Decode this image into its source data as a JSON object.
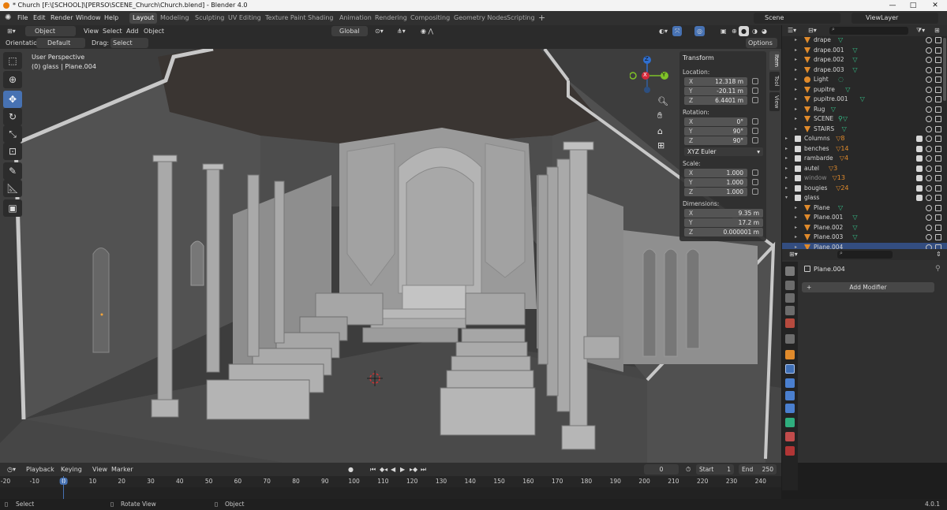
{
  "window": {
    "title": "* Church [F:\\[SCHOOL]\\[PERSO\\SCENE_Church\\Church.blend] - Blender 4.0",
    "minimize": "—",
    "maximize": "□",
    "close": "✕"
  },
  "menu": [
    "File",
    "Edit",
    "Render",
    "Window",
    "Help"
  ],
  "workspaces": [
    "Layout",
    "Modeling",
    "Sculpting",
    "UV Editing",
    "Texture Paint",
    "Shading",
    "Animation",
    "Rendering",
    "Compositing",
    "Geometry Nodes",
    "Scripting"
  ],
  "active_workspace": "Layout",
  "scene": {
    "name": "Scene",
    "view_layer": "ViewLayer"
  },
  "viewport_header": {
    "mode": "Object Mode",
    "menus": [
      "View",
      "Select",
      "Add",
      "Object"
    ],
    "transform_orientation": "Global",
    "orientation_label": "Orientation:",
    "orientation_value": "Default",
    "drag_label": "Drag:",
    "drag_value": "Select Box",
    "options": "Options"
  },
  "viewport_overlay": {
    "perspective": "User Perspective",
    "object_info": "(0) glass | Plane.004"
  },
  "gizmo_axes": {
    "x": "X",
    "y": "Y",
    "z": "Z"
  },
  "npanel": {
    "section": "Transform",
    "location_label": "Location:",
    "location": [
      {
        "axis": "X",
        "value": "12.318 m"
      },
      {
        "axis": "Y",
        "value": "-20.11 m"
      },
      {
        "axis": "Z",
        "value": "6.4401 m"
      }
    ],
    "rotation_label": "Rotation:",
    "rotation": [
      {
        "axis": "X",
        "value": "0°"
      },
      {
        "axis": "Y",
        "value": "90°"
      },
      {
        "axis": "Z",
        "value": "90°"
      }
    ],
    "rotation_mode": "XYZ Euler",
    "scale_label": "Scale:",
    "scale": [
      {
        "axis": "X",
        "value": "1.000"
      },
      {
        "axis": "Y",
        "value": "1.000"
      },
      {
        "axis": "Z",
        "value": "1.000"
      }
    ],
    "dimensions_label": "Dimensions:",
    "dimensions": [
      {
        "axis": "X",
        "value": "9.35 m"
      },
      {
        "axis": "Y",
        "value": "17.2 m"
      },
      {
        "axis": "Z",
        "value": "0.000001 m"
      }
    ],
    "tabs": [
      "Item",
      "Tool",
      "View"
    ]
  },
  "outliner": {
    "rows": [
      {
        "name": "drape",
        "type": "mesh",
        "indent": 2,
        "dec": "▽",
        "chk": false
      },
      {
        "name": "drape.001",
        "type": "mesh",
        "indent": 2,
        "dec": "▽",
        "chk": false
      },
      {
        "name": "drape.002",
        "type": "mesh",
        "indent": 2,
        "dec": "▽",
        "chk": false
      },
      {
        "name": "drape.003",
        "type": "mesh",
        "indent": 2,
        "dec": "▽",
        "chk": false
      },
      {
        "name": "Light",
        "type": "light",
        "indent": 2,
        "dec": "◌",
        "chk": false
      },
      {
        "name": "pupitre",
        "type": "mesh",
        "indent": 2,
        "dec": "▽",
        "chk": false
      },
      {
        "name": "pupitre.001",
        "type": "mesh",
        "indent": 2,
        "dec": "▽",
        "chk": false
      },
      {
        "name": "Rug",
        "type": "mesh",
        "indent": 2,
        "dec": "▽",
        "chk": false
      },
      {
        "name": "SCENE",
        "type": "mesh",
        "indent": 2,
        "dec": "⚲▽",
        "chk": false
      },
      {
        "name": "STAIRS",
        "type": "mesh",
        "indent": 2,
        "dec": "▽",
        "chk": false
      },
      {
        "name": "Columns",
        "type": "collection",
        "indent": 1,
        "dec": "▽8",
        "chk": true
      },
      {
        "name": "benches",
        "type": "collection",
        "indent": 1,
        "dec": "▽14",
        "chk": true
      },
      {
        "name": "rambarde",
        "type": "collection",
        "indent": 1,
        "dec": "▽4",
        "chk": true
      },
      {
        "name": "autel",
        "type": "collection",
        "indent": 1,
        "dec": "▽3",
        "chk": true
      },
      {
        "name": "window",
        "type": "collection",
        "indent": 1,
        "dec": "▽13",
        "chk": true,
        "dim": true
      },
      {
        "name": "bougies",
        "type": "collection",
        "indent": 1,
        "dec": "▽24",
        "chk": true
      },
      {
        "name": "glass",
        "type": "collection",
        "indent": 1,
        "dec": "",
        "chk": true,
        "open": true
      },
      {
        "name": "Plane",
        "type": "mesh",
        "indent": 2,
        "dec": "▽",
        "chk": false
      },
      {
        "name": "Plane.001",
        "type": "mesh",
        "indent": 2,
        "dec": "▽",
        "chk": false
      },
      {
        "name": "Plane.002",
        "type": "mesh",
        "indent": 2,
        "dec": "▽",
        "chk": false
      },
      {
        "name": "Plane.003",
        "type": "mesh",
        "indent": 2,
        "dec": "▽",
        "chk": false
      },
      {
        "name": "Plane.004",
        "type": "mesh",
        "indent": 2,
        "dec": "",
        "chk": false
      }
    ]
  },
  "properties": {
    "object": "Plane.004",
    "add_modifier": "Add Modifier"
  },
  "timeline": {
    "menus": [
      "Playback",
      "Keying",
      "View",
      "Marker"
    ],
    "current_frame": "0",
    "start_label": "Start",
    "start": "1",
    "end_label": "End",
    "end": "250",
    "ticks": [
      "-20",
      "-10",
      "0",
      "10",
      "20",
      "30",
      "40",
      "50",
      "60",
      "70",
      "80",
      "90",
      "100",
      "110",
      "120",
      "130",
      "140",
      "150",
      "160",
      "170",
      "180",
      "190",
      "200",
      "210",
      "220",
      "230",
      "240"
    ]
  },
  "statusbar": {
    "select": "Select",
    "rotate": "Rotate View",
    "object": "Object",
    "version": "4.0.1"
  }
}
